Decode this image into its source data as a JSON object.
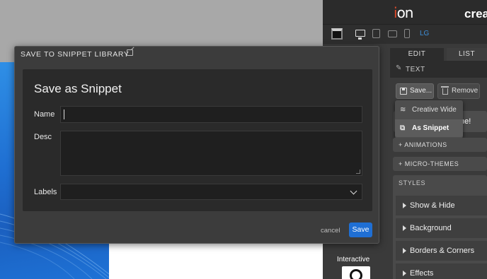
{
  "panel": {
    "logo_text": "ion",
    "brand_text": "crea",
    "device_lg": "LG",
    "tabs": [
      "EDIT",
      "LIST"
    ],
    "section_text": "TEXT",
    "save_button": "Save...",
    "remove_button": "Remove",
    "dropdown": [
      "Creative Wide",
      "As Snippet"
    ],
    "behind_text": "ne!",
    "animations": "+ ANIMATIONS",
    "micro_themes": "+ MICRO-THEMES",
    "styles_head": "STYLES",
    "style_rows": [
      "Show & Hide",
      "Background",
      "Borders & Corners",
      "Effects"
    ],
    "interactive": "Interactive"
  },
  "modal": {
    "title": "SAVE TO SNIPPET LIBRARY",
    "heading": "Save as Snippet",
    "labels": {
      "name": "Name",
      "desc": "Desc",
      "labels": "Labels"
    },
    "values": {
      "name": "",
      "desc": "",
      "labels": ""
    },
    "cancel": "cancel",
    "save": "Save"
  },
  "colors": {
    "accent": "#1f6fd4",
    "logo_accent": "#e04b2b",
    "link_lg": "#3e8fd9"
  }
}
